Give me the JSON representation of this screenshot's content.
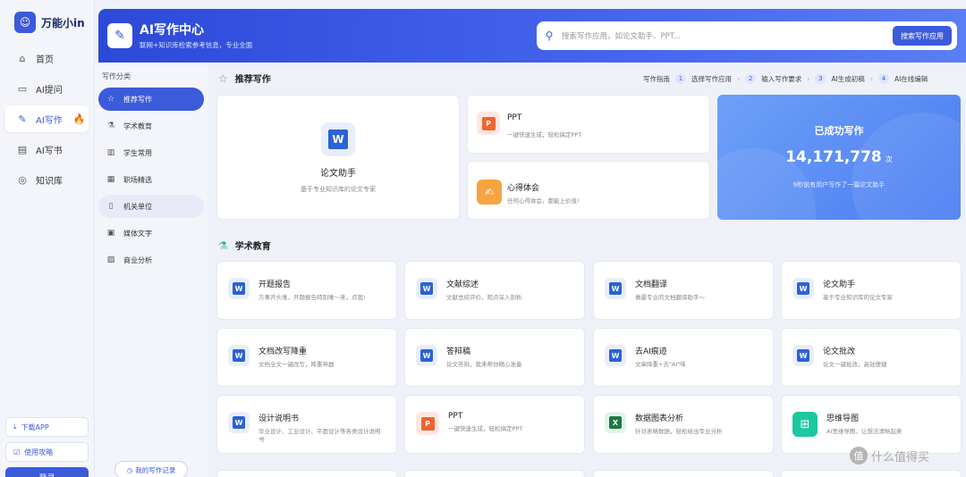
{
  "brand": {
    "name": "万能小in"
  },
  "nav": {
    "items": [
      {
        "label": "首页",
        "icon": "home-icon"
      },
      {
        "label": "AI提问",
        "icon": "chat-icon"
      },
      {
        "label": "AI写作",
        "icon": "pen-icon"
      },
      {
        "label": "AI写书",
        "icon": "book-icon"
      },
      {
        "label": "知识库",
        "icon": "knowledge-icon"
      }
    ],
    "download": "下载APP",
    "guide": "使用攻略",
    "login": "登录"
  },
  "banner": {
    "title": "AI写作中心",
    "subtitle": "联网+知识库检索参考信息，专业全面",
    "search_placeholder": "搜索写作应用，如论文助手、PPT...",
    "search_button": "搜索写作应用"
  },
  "categories": {
    "title": "写作分类",
    "items": [
      "推荐写作",
      "学术教育",
      "学生常用",
      "职场精选",
      "机关单位",
      "媒体文字",
      "商业分析"
    ],
    "history": "我的写作记录"
  },
  "recommend": {
    "title": "推荐写作",
    "guide_label": "写作指南",
    "steps": [
      {
        "no": "1",
        "label": "选择写作应用"
      },
      {
        "no": "2",
        "label": "输入写作要求"
      },
      {
        "no": "3",
        "label": "AI生成初稿"
      },
      {
        "no": "4",
        "label": "AI在线编辑"
      }
    ],
    "featured": {
      "title": "论文助手",
      "desc": "基于专业知识库的论文专家"
    },
    "ppt": {
      "title": "PPT",
      "desc": "一键快速生成，轻松搞定PPT"
    },
    "heart": {
      "title": "心得体会",
      "desc": "任何心得体会，都能上价值!"
    },
    "stats": {
      "title": "已成功写作",
      "count": "14,171,778",
      "unit": "次",
      "desc": "9秒前有用户写作了一篇论文助手"
    }
  },
  "academic": {
    "title": "学术教育",
    "cards": [
      {
        "title": "开题报告",
        "desc": "万事开头难，开题报告特别难～来，点我!",
        "icon": "word"
      },
      {
        "title": "文献综述",
        "desc": "文献总结评价，观点深入剖析",
        "icon": "word"
      },
      {
        "title": "文档翻译",
        "desc": "做最专业的文档翻译助手～",
        "icon": "word"
      },
      {
        "title": "论文助手",
        "desc": "基于专业知识库的论文专家",
        "icon": "word"
      },
      {
        "title": "文档改写降重",
        "desc": "文档全文一键改写，降重神器",
        "icon": "word"
      },
      {
        "title": "答辩稿",
        "desc": "论文答辩，我来帮你精心准备",
        "icon": "word"
      },
      {
        "title": "去AI痕迹",
        "desc": "文章降重+去\"AI\"味",
        "icon": "word"
      },
      {
        "title": "论文批改",
        "desc": "论文一键批改，高效便捷",
        "icon": "word"
      },
      {
        "title": "设计说明书",
        "desc": "毕业设计、工业设计、平面设计等各类设计说明书",
        "icon": "word"
      },
      {
        "title": "PPT",
        "desc": "一键快速生成，轻松搞定PPT",
        "icon": "ppt"
      },
      {
        "title": "数据图表分析",
        "desc": "针对表格数据，轻松给出专业分析",
        "icon": "excel"
      },
      {
        "title": "思维导图",
        "desc": "AI思维导图，让想法清晰起来",
        "icon": "mind"
      }
    ]
  },
  "watermark": "什么值得买",
  "colors": {
    "primary": "#3b5bdb",
    "accent_green": "#3bb28f",
    "fire": "#ff4d4f"
  }
}
